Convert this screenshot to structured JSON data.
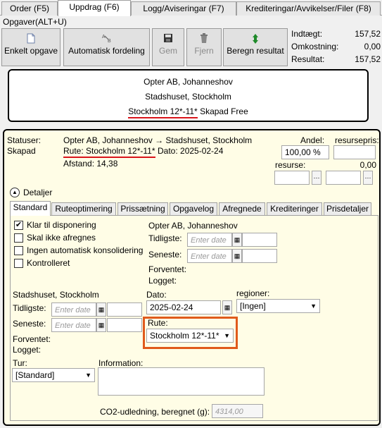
{
  "top_tabs": [
    {
      "label": "Order (F5)"
    },
    {
      "label": "Uppdrag (F6)"
    },
    {
      "label": "Logg/Aviseringar (F7)"
    },
    {
      "label": "Krediteringar/Avvikelser/Filer (F8)"
    }
  ],
  "menu": {
    "label": "Opgaver(ALT+U)"
  },
  "toolbar": {
    "enkelt": "Enkelt opgave",
    "auto": "Automatisk fordeling",
    "gem": "Gem",
    "fjern": "Fjern",
    "beregn": "Beregn resultat"
  },
  "summary": {
    "indtaegt_label": "Indtægt:",
    "indtaegt_value": "157,52",
    "omkostning_label": "Omkostning:",
    "omkostning_value": "0,00",
    "resultat_label": "Resultat:",
    "resultat_value": "157,52"
  },
  "address_box": {
    "line1": "Opter AB, Johanneshov",
    "line2": "Stadshuset, Stockholm",
    "route": "Stockholm 12*-11*",
    "status": "Skapad Free"
  },
  "info": {
    "statuser_label": "Statuser:",
    "status_value": "Skapad",
    "route_summary": "Opter AB, Johanneshov → Stadshuset, Stockholm",
    "rute_text": "Rute: Stockholm 12*-11*",
    "dato_text": "Dato: 2025-02-24",
    "afstand_text": "Afstand: 14,38",
    "andel_label": "Andel:",
    "andel_value": "100,00 %",
    "ressurspris_label": "resursepris:",
    "resurse_label": "resurse:",
    "resurse_value": "0,00"
  },
  "detaljer": {
    "label": "Detaljer"
  },
  "inner_tabs": [
    {
      "label": "Standard"
    },
    {
      "label": "Ruteoptimering"
    },
    {
      "label": "Prissætning"
    },
    {
      "label": "Opgavelog"
    },
    {
      "label": "Afregnede"
    },
    {
      "label": "Krediteringer"
    },
    {
      "label": "Prisdetaljer"
    }
  ],
  "checkboxes": [
    {
      "label": "Klar til disponering",
      "checked": true
    },
    {
      "label": "Skal ikke afregnes",
      "checked": false
    },
    {
      "label": "Ingen automatisk konsolidering",
      "checked": false
    },
    {
      "label": "Kontrolleret",
      "checked": false
    }
  ],
  "pickup": {
    "name": "Opter AB, Johanneshov",
    "tidligste_label": "Tidligste:",
    "seneste_label": "Seneste:",
    "forventet_label": "Forventet:",
    "logget_label": "Logget:",
    "placeholder": "Enter date"
  },
  "delivery": {
    "name": "Stadshuset, Stockholm",
    "tidligste_label": "Tidligste:",
    "seneste_label": "Seneste:",
    "forventet_label": "Forventet:",
    "logget_label": "Logget:",
    "placeholder": "Enter date"
  },
  "dato": {
    "label": "Dato:",
    "value": "2025-02-24"
  },
  "regioner": {
    "label": "regioner:",
    "value": "[Ingen]"
  },
  "rute": {
    "label": "Rute:",
    "value": "Stockholm 12*-11*"
  },
  "tur": {
    "label": "Tur:",
    "value": "[Standard]"
  },
  "information": {
    "label": "Information:"
  },
  "co2": {
    "label": "CO2-udledning, beregnet (g):",
    "value": "4314,00"
  },
  "colors": {
    "highlight_red": "#d9141b",
    "highlight_orange": "#e05a1c",
    "panel_bg": "#fffde6"
  }
}
